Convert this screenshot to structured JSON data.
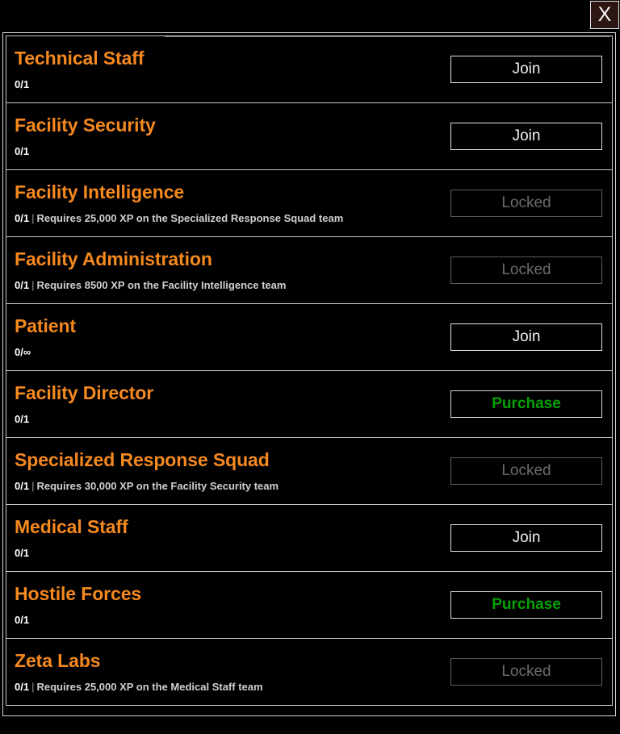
{
  "window": {
    "background_color": "#000000",
    "accent_color": "#f5891f",
    "close_button": {
      "label": "X",
      "icon": "close-icon",
      "background_color": "#2b1614",
      "text_color": "#f2f2f2"
    }
  },
  "panel": {
    "border_color": "#d8d8d8"
  },
  "button_states": {
    "join": {
      "label": "Join",
      "color": "#f2f2f2"
    },
    "purchase": {
      "label": "Purchase",
      "color": "#04a004"
    },
    "locked": {
      "label": "Locked",
      "color": "#6b6b6b"
    }
  },
  "teams": [
    {
      "name": "Technical Staff",
      "count": "0/1",
      "requirement": "",
      "action_label": "Join",
      "action_state": "join"
    },
    {
      "name": "Facility Security",
      "count": "0/1",
      "requirement": "",
      "action_label": "Join",
      "action_state": "join"
    },
    {
      "name": "Facility Intelligence",
      "count": "0/1",
      "requirement": "Requires 25,000 XP on the Specialized Response Squad team",
      "action_label": "Locked",
      "action_state": "locked"
    },
    {
      "name": "Facility Administration",
      "count": "0/1",
      "requirement": "Requires 8500 XP on the Facility Intelligence team",
      "action_label": "Locked",
      "action_state": "locked"
    },
    {
      "name": "Patient",
      "count": "0/∞",
      "requirement": "",
      "action_label": "Join",
      "action_state": "join"
    },
    {
      "name": "Facility Director",
      "count": "0/1",
      "requirement": "",
      "action_label": "Purchase",
      "action_state": "purchase"
    },
    {
      "name": "Specialized Response Squad",
      "count": "0/1",
      "requirement": "Requires 30,000 XP on the Facility Security team",
      "action_label": "Locked",
      "action_state": "locked"
    },
    {
      "name": "Medical Staff",
      "count": "0/1",
      "requirement": "",
      "action_label": "Join",
      "action_state": "join"
    },
    {
      "name": "Hostile Forces",
      "count": "0/1",
      "requirement": "",
      "action_label": "Purchase",
      "action_state": "purchase"
    },
    {
      "name": "Zeta Labs",
      "count": "0/1",
      "requirement": "Requires 25,000 XP on the Medical Staff team",
      "action_label": "Locked",
      "action_state": "locked"
    }
  ]
}
